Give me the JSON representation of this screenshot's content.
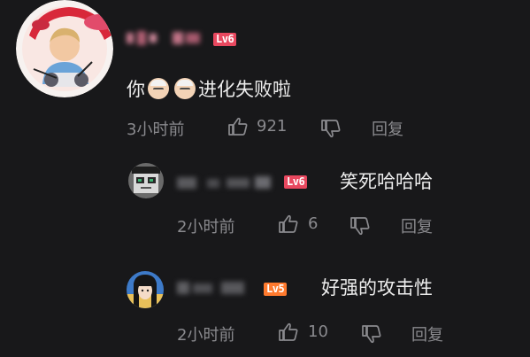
{
  "comment": {
    "username_obscured": "用户名",
    "level": "Lv6",
    "text_before": "你",
    "emoji_names": [
      "old-man-emoji",
      "old-man-emoji"
    ],
    "text_after": "进化失败啦",
    "time": "3小时前",
    "likes": "921",
    "reply_label": "回复"
  },
  "replies": [
    {
      "username_obscured": "用户名I",
      "level": "Lv6",
      "text": "笑死哈哈哈",
      "time": "2小时前",
      "likes": "6",
      "reply_label": "回复"
    },
    {
      "username_obscured": "用户名",
      "level": "Lv5",
      "text": "好强的攻击性",
      "time": "2小时前",
      "likes": "10",
      "reply_label": "回复"
    }
  ],
  "colors": {
    "background": "#18181a",
    "level6": "#e8485f",
    "level5": "#ff7a2e",
    "meta": "#8a8a8e"
  }
}
